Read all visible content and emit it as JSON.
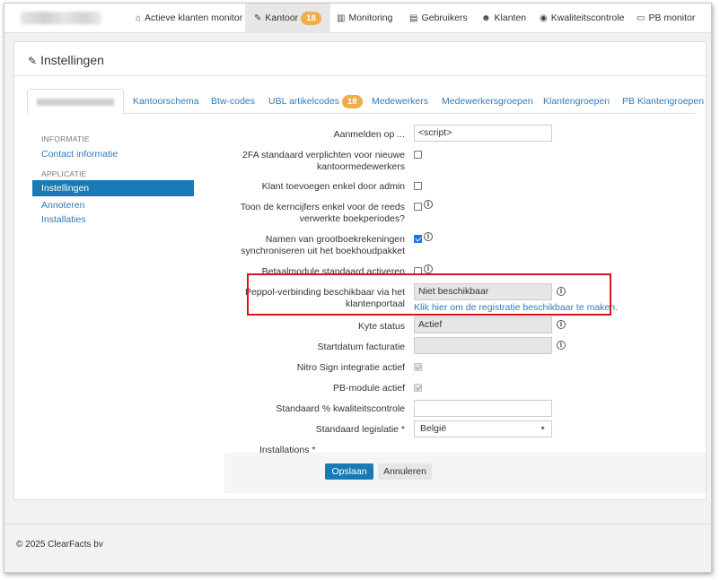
{
  "nav": {
    "items": [
      {
        "icon": "home-icon",
        "glyph": "⌂",
        "label": "Actieve klanten monitor"
      },
      {
        "icon": "wrench-icon",
        "glyph": "🔧",
        "label": "Kantoor",
        "badge": "18"
      },
      {
        "icon": "chart-icon",
        "glyph": "▥",
        "label": "Monitoring"
      },
      {
        "icon": "users-list-icon",
        "glyph": "▤",
        "label": "Gebruikers"
      },
      {
        "icon": "group-icon",
        "glyph": "👥",
        "label": "Klanten"
      },
      {
        "icon": "eye-icon",
        "glyph": "◉",
        "label": "Kwaliteitscontrole"
      },
      {
        "icon": "monitor-icon",
        "glyph": "▭",
        "label": "PB monitor"
      }
    ]
  },
  "page": {
    "title": "Instellingen"
  },
  "tabs": [
    {
      "label": "Kantoorschema"
    },
    {
      "label": "Btw-codes"
    },
    {
      "label": "UBL artikelcodes",
      "badge": "18"
    },
    {
      "label": "Medewerkers"
    },
    {
      "label": "Medewerkersgroepen"
    },
    {
      "label": "Klantengroepen"
    },
    {
      "label": "PB Klantengroepen"
    }
  ],
  "side": {
    "heading_info": "INFORMATIE",
    "contact": "Contact informatie",
    "heading_app": "APPLICATIE",
    "instellingen": "Instellingen",
    "annoteren": "Annoteren",
    "installaties": "Installaties"
  },
  "form": {
    "aanmelden_label": "Aanmelden op ...",
    "aanmelden_value": "<script>",
    "twofa_label": "2FA standaard verplichten voor nieuwe kantoormedewerkers",
    "klant_admin_label": "Klant toevoegen enkel door admin",
    "kerncijfers_label": "Toon de kerncijfers enkel voor de reeds verwerkte boekperiodes?",
    "namen_label": "Namen van grootboekrekeningen synchroniseren uit het boekhoudpakket",
    "betaal_label": "Betaalmodule standaard activeren",
    "peppol_label": "Peppol-verbinding beschikbaar via het klantenportaal",
    "peppol_value": "Niet beschikbaar",
    "peppol_link": "Klik hier om de registratie beschikbaar te maken.",
    "kyte_label": "Kyte status",
    "kyte_value": "Actief",
    "startdatum_label": "Startdatum facturatie",
    "startdatum_value": "",
    "nitro_label": "Nitro Sign integratie actief",
    "pb_label": "PB-module actief",
    "kwaliteit_label": "Standaard % kwaliteitscontrole",
    "kwaliteit_value": "",
    "legislatie_label": "Standaard legislatie *",
    "legislatie_value": "België",
    "installations_label": "Installations *",
    "twofa_checked": false,
    "klant_admin_checked": false,
    "kerncijfers_checked": false,
    "namen_checked": true,
    "betaal_checked": false,
    "nitro_checked": true,
    "pb_checked": true
  },
  "actions": {
    "save": "Opslaan",
    "cancel": "Annuleren"
  },
  "footer": {
    "copyright": "© 2025 ClearFacts bv"
  },
  "colors": {
    "accent": "#1a7ab5",
    "link": "#337ab7",
    "badge": "#f0ad4e",
    "highlight": "#d9141b"
  }
}
